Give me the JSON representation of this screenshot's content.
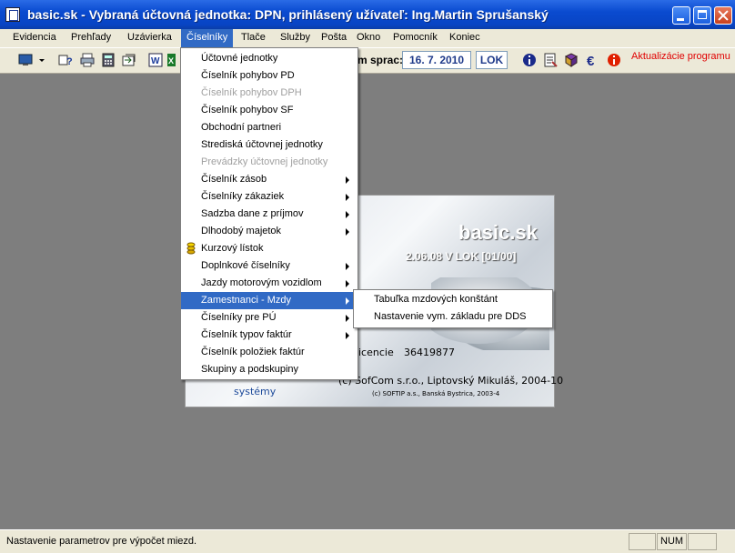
{
  "window": {
    "title": "basic.sk - Vybraná účtovná jednotka: DPN,  prihlásený užívateľ: Ing.Martin Sprušanský"
  },
  "menubar": [
    "Evidencia",
    "Prehľady",
    "Uzávierka",
    "Číselníky",
    "Tlače",
    "Služby",
    "Pošta",
    "Okno",
    "Pomocník",
    "Koniec"
  ],
  "toolbar": {
    "sprac_label": "m sprac:",
    "date": "16. 7. 2010",
    "lok": "LOK",
    "update_link": "Aktualizácie programu"
  },
  "ciselniky_menu": [
    {
      "label": "Účtovné jednotky",
      "enabled": true,
      "submenu": false
    },
    {
      "label": "Číselník pohybov PD",
      "enabled": true,
      "submenu": false
    },
    {
      "label": "Číselník pohybov DPH",
      "enabled": false,
      "submenu": false
    },
    {
      "label": "Číselník pohybov SF",
      "enabled": true,
      "submenu": false
    },
    {
      "label": "Obchodní partneri",
      "enabled": true,
      "submenu": false
    },
    {
      "label": "Strediská účtovnej jednotky",
      "enabled": true,
      "submenu": false
    },
    {
      "label": "Prevádzky účtovnej jednotky",
      "enabled": false,
      "submenu": false
    },
    {
      "label": "Číselník zásob",
      "enabled": true,
      "submenu": true
    },
    {
      "label": "Číselníky zákaziek",
      "enabled": true,
      "submenu": true
    },
    {
      "label": "Sadzba dane z príjmov",
      "enabled": true,
      "submenu": true
    },
    {
      "label": "Dlhodobý majetok",
      "enabled": true,
      "submenu": true
    },
    {
      "label": "Kurzový lístok",
      "enabled": true,
      "submenu": false,
      "icon": "coin-stack-icon"
    },
    {
      "label": "Doplnkové číselníky",
      "enabled": true,
      "submenu": true
    },
    {
      "label": "Jazdy motorovým vozidlom",
      "enabled": true,
      "submenu": true
    },
    {
      "label": "Zamestnanci - Mzdy",
      "enabled": true,
      "submenu": true,
      "selected": true
    },
    {
      "label": "Číselníky pre PÚ",
      "enabled": true,
      "submenu": true
    },
    {
      "label": "Číselník typov faktúr",
      "enabled": true,
      "submenu": true
    },
    {
      "label": "Číselník položiek faktúr",
      "enabled": true,
      "submenu": false
    },
    {
      "label": "Skupiny a podskupiny",
      "enabled": true,
      "submenu": false
    }
  ],
  "mzdy_submenu": [
    "Tabuľka mzdových konštánt",
    "Nastavenie vym. základu pre DDS"
  ],
  "splash": {
    "brand": "basic.sk",
    "version": "2.06.08  V  LOK [01/00]",
    "license_label": "icencie",
    "license_number": "36419877",
    "copyright": "(c) SofCom s.r.o., Liptovský Mikuláš, 2004-10",
    "copyright2": "(c) SOFTIP a.s., Banská Bystrica, 2003-4",
    "systems": "systémy"
  },
  "statusbar": {
    "message": "Nastavenie parametrov pre výpočet miezd.",
    "num": "NUM"
  },
  "colors": {
    "title_blue": "#0a4bd0",
    "menu_highlight": "#316ac5",
    "update_red": "#e00000",
    "workspace": "#7e7e7e"
  }
}
